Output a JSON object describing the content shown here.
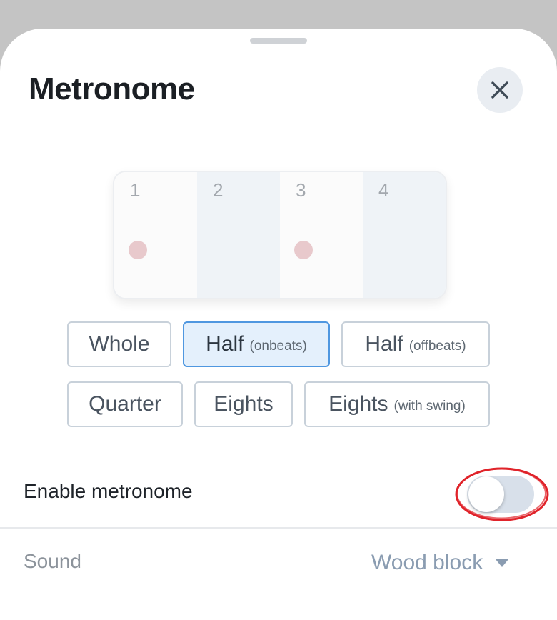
{
  "sheet": {
    "title": "Metronome"
  },
  "beats": [
    {
      "number": "1",
      "active": true
    },
    {
      "number": "2",
      "active": false
    },
    {
      "number": "3",
      "active": true
    },
    {
      "number": "4",
      "active": false
    }
  ],
  "patterns": [
    {
      "label": "Whole",
      "sub": "",
      "selected": false
    },
    {
      "label": "Half",
      "sub": "(onbeats)",
      "selected": true
    },
    {
      "label": "Half",
      "sub": "(offbeats)",
      "selected": false
    },
    {
      "label": "Quarter",
      "sub": "",
      "selected": false
    },
    {
      "label": "Eights",
      "sub": "",
      "selected": false
    },
    {
      "label": "Eights",
      "sub": "(with swing)",
      "selected": false
    }
  ],
  "settings": {
    "enable_label": "Enable metronome",
    "enabled": false,
    "sound_label": "Sound",
    "sound_value": "Wood block"
  },
  "colors": {
    "selected_border": "#4f97e0",
    "beat_dot": "#e8c9cc",
    "annotation": "#e0242b"
  }
}
